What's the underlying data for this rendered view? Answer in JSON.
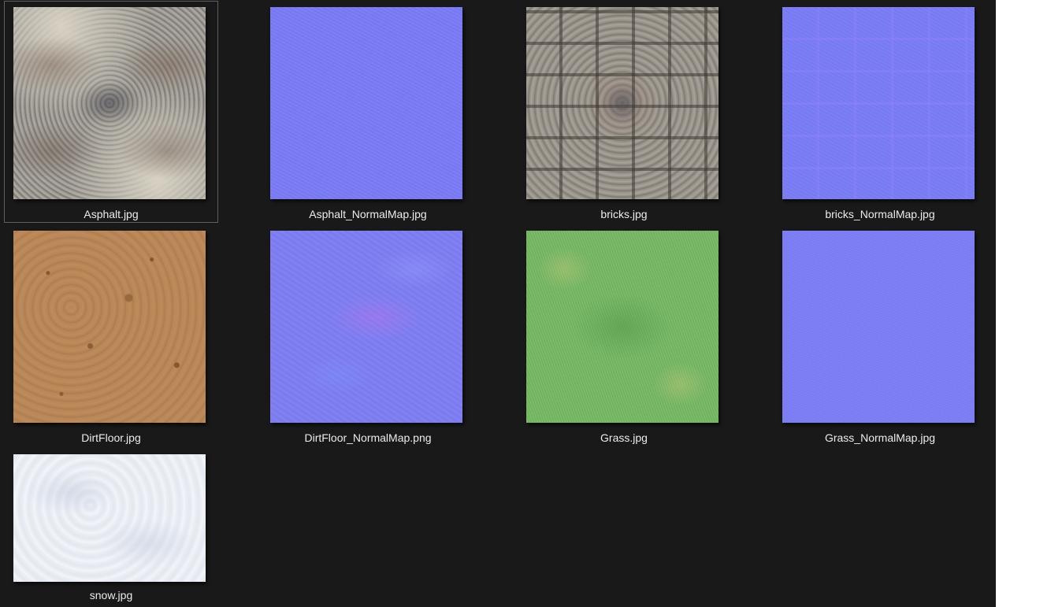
{
  "files": [
    {
      "name": "Asphalt.jpg",
      "texture": "asphalt",
      "selected": true
    },
    {
      "name": "Asphalt_NormalMap.jpg",
      "texture": "normal",
      "selected": false
    },
    {
      "name": "bricks.jpg",
      "texture": "bricks",
      "selected": false
    },
    {
      "name": "bricks_NormalMap.jpg",
      "texture": "bricksnormal",
      "selected": false
    },
    {
      "name": "DirtFloor.jpg",
      "texture": "dirt",
      "selected": false
    },
    {
      "name": "DirtFloor_NormalMap.png",
      "texture": "dirtnormal",
      "selected": false
    },
    {
      "name": "Grass.jpg",
      "texture": "grass",
      "selected": false
    },
    {
      "name": "Grass_NormalMap.jpg",
      "texture": "grassnormal",
      "selected": false
    },
    {
      "name": "snow.jpg",
      "texture": "snow",
      "selected": false
    }
  ],
  "colors": {
    "background": "#191919",
    "label_text": "#ececec",
    "selection_border": "#5f5f5f",
    "right_pane": "#ffffff"
  }
}
